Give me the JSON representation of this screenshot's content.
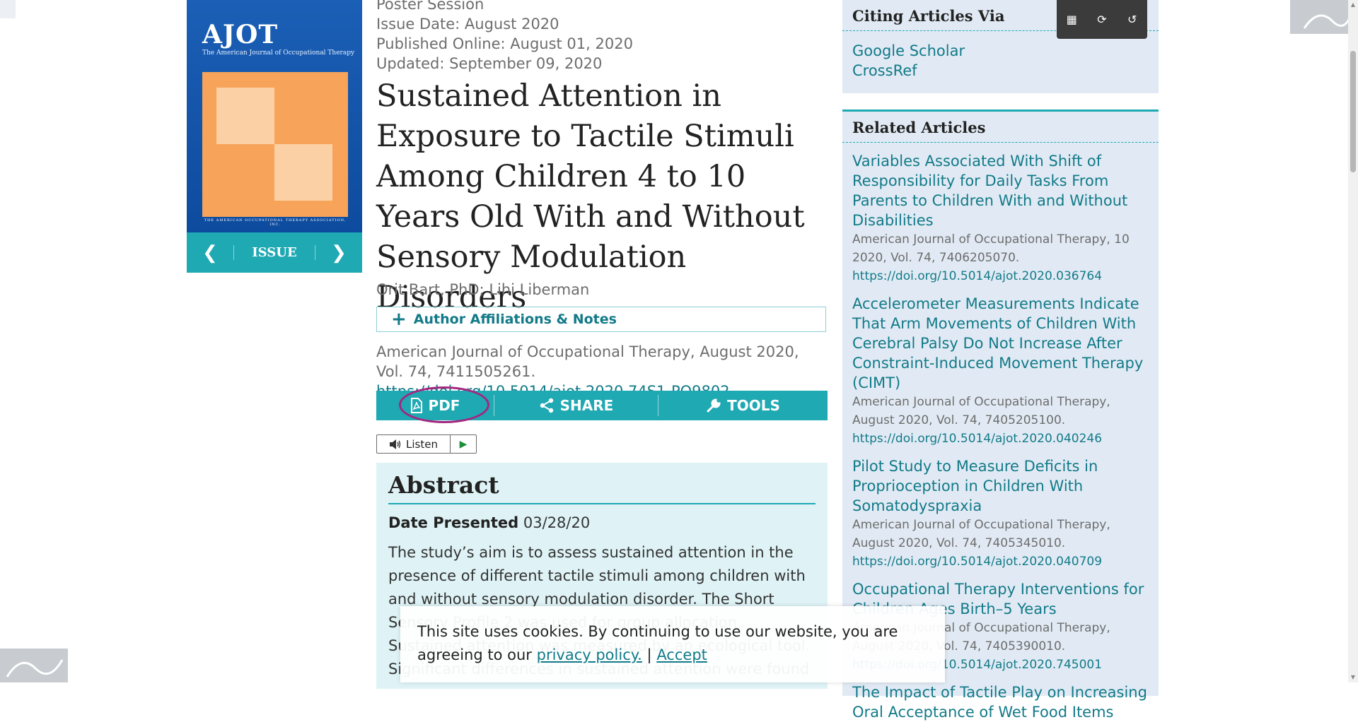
{
  "cover": {
    "logo": "AJOT",
    "subtitle": "The American Journal of Occupational Therapy",
    "footer": "THE AMERICAN OCCUPATIONAL THERAPY ASSOCIATION, INC.",
    "issue_label": "ISSUE",
    "prev": "❮",
    "next": "❯"
  },
  "article": {
    "session": "Poster Session",
    "issue_date": "Issue Date: August 2020",
    "published": "Published Online: August 01, 2020",
    "updated": "Updated: September 09, 2020",
    "title": "Sustained Attention in Exposure to Tactile Stimuli Among Children 4 to 10 Years Old With and Without Sensory Modulation Disorders",
    "author1": "Orit Bart, PhD",
    "author_sep": ";",
    "author2": "Lihi Liberman",
    "affiliations_label": "Author Affiliations & Notes",
    "citation_text": "American Journal of Occupational Therapy, August 2020, Vol. 74, 7411505261.",
    "citation_doi": "https://doi.org/10.5014/ajot.2020.74S1-PO9802"
  },
  "toolbar": {
    "pdf": "PDF",
    "share": "SHARE",
    "tools": "TOOLS"
  },
  "listen": {
    "label": "Listen"
  },
  "abstract": {
    "heading": "Abstract",
    "date_label": "Date Presented",
    "date_value": "03/28/20",
    "body": "The study’s aim is to assess sustained attention in the presence of different tactile stimuli among children with and without sensory modulation disorder. The Short Sensory Profile 2 was used for group allocation. Sustained attention was measured by an ecological tool. Significant differences in sustained attention were found"
  },
  "citing": {
    "heading": "Citing Articles Via",
    "links": [
      "Google Scholar",
      "CrossRef"
    ]
  },
  "related": {
    "heading": "Related Articles",
    "items": [
      {
        "title": "Variables Associated With Shift of Responsibility for Daily Tasks From Parents to Children With and Without Disabilities",
        "meta": "American Journal of Occupational Therapy, 10 2020, Vol. 74, 7406205070.",
        "doi": "https://doi.org/10.5014/ajot.2020.036764"
      },
      {
        "title": "Accelerometer Measurements Indicate That Arm Movements of Children With Cerebral Palsy Do Not Increase After Constraint-Induced Movement Therapy (CIMT)",
        "meta": "American Journal of Occupational Therapy, August 2020, Vol. 74, 7405205100.",
        "doi": "https://doi.org/10.5014/ajot.2020.040246"
      },
      {
        "title": "Pilot Study to Measure Deficits in Proprioception in Children With Somatodyspraxia",
        "meta": "American Journal of Occupational Therapy, August 2020, Vol. 74, 7405345010.",
        "doi": "https://doi.org/10.5014/ajot.2020.040709"
      },
      {
        "title": "Occupational Therapy Interventions for Children Ages Birth–5 Years",
        "meta": "American Journal of Occupational Therapy, August 2020, Vol. 74, 7405390010.",
        "doi": "https://doi.org/10.5014/ajot.2020.745001"
      },
      {
        "title": "The Impact of Tactile Play on Increasing Oral Acceptance of Wet Food Items",
        "meta": "",
        "doi": ""
      }
    ]
  },
  "cookie": {
    "text": "This site uses cookies. By continuing to use our website, you are agreeing to our",
    "privacy": "privacy policy.",
    "sep": "|",
    "accept": "Accept"
  },
  "icons": {
    "pdf": "pdf-file-icon",
    "share": "share-icon",
    "tools": "wrench-icon",
    "speaker": "speaker-icon",
    "play": "play-icon"
  },
  "colors": {
    "teal": "#1fa9b3",
    "link": "#127a88",
    "cover_blue": "#1b5fb6",
    "cover_orange": "#f7a45a",
    "highlight_ring": "#a3277f",
    "abstract_bg": "#dff3f6",
    "sidebar_bg": "#e1eaf4"
  }
}
